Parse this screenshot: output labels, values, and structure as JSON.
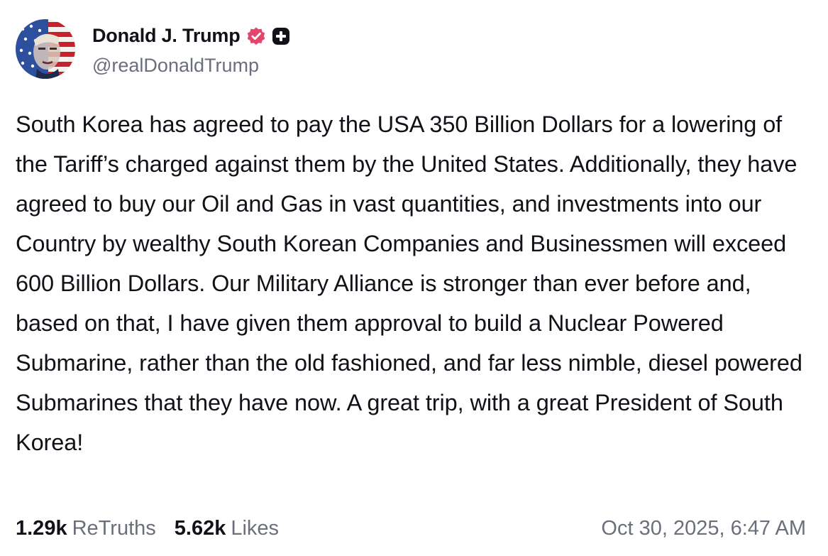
{
  "post": {
    "author": {
      "display_name": "Donald J. Trump",
      "handle": "@realDonaldTrump",
      "avatar_icon": "avatar-flag-portrait",
      "verified_icon": "verified-badge-icon",
      "plus_icon": "plus-badge-icon"
    },
    "text": "South Korea has agreed to pay the USA 350 Billion Dollars for a lowering of the Tariff’s charged against them by the United States. Additionally, they have agreed to buy our Oil and Gas in vast quantities, and investments into our Country by wealthy South Korean Companies and Businessmen will exceed 600 Billion Dollars. Our Military Alliance is stronger than ever before and, based on that, I have given them approval to build a Nuclear Powered Submarine, rather than the old fashioned, and far less nimble, diesel powered Submarines that they have now. A great trip, with a great President of South Korea!",
    "stats": {
      "retruths_count": "1.29k",
      "retruths_label": "ReTruths",
      "likes_count": "5.62k",
      "likes_label": "Likes"
    },
    "timestamp": "Oct 30, 2025, 6:47 AM"
  },
  "colors": {
    "text_primary": "#111118",
    "text_secondary": "#6b6f7b",
    "verified_badge": "#e4466b",
    "plus_badge": "#111118",
    "background": "#ffffff"
  }
}
